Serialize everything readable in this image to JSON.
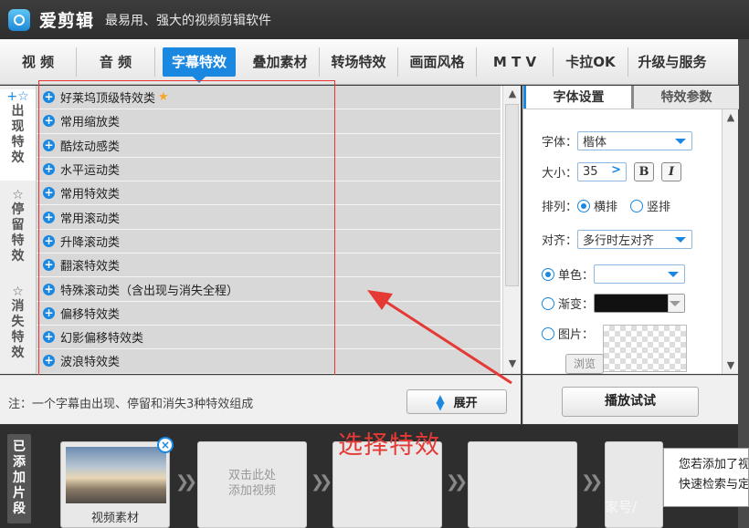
{
  "app": {
    "name": "爱剪辑",
    "slogan": "最易用、强大的视频剪辑软件"
  },
  "tabs": [
    {
      "label": "视 频"
    },
    {
      "label": "音 频"
    },
    {
      "label": "字幕特效",
      "active": true
    },
    {
      "label": "叠加素材"
    },
    {
      "label": "转场特效"
    },
    {
      "label": "画面风格"
    },
    {
      "label": "M T V"
    },
    {
      "label": "卡拉OK"
    },
    {
      "label": "升级与服务"
    }
  ],
  "side_tabs": [
    {
      "icon": "+☆",
      "label": "出现特效",
      "active": true
    },
    {
      "icon": "☆",
      "label": "停留特效"
    },
    {
      "icon": "☆",
      "label": "消失特效"
    }
  ],
  "effects": [
    {
      "label": "好莱坞顶级特效类",
      "starred": true
    },
    {
      "label": "常用缩放类"
    },
    {
      "label": "酷炫动感类"
    },
    {
      "label": "水平运动类"
    },
    {
      "label": "常用特效类"
    },
    {
      "label": "常用滚动类"
    },
    {
      "label": "升降滚动类"
    },
    {
      "label": "翻滚特效类"
    },
    {
      "label": "特殊滚动类（含出现与消失全程）"
    },
    {
      "label": "偏移特效类"
    },
    {
      "label": "幻影偏移特效类"
    },
    {
      "label": "波浪特效类"
    }
  ],
  "settings": {
    "tabs": [
      "字体设置",
      "特效参数"
    ],
    "font_label": "字体：",
    "font_value": "楷体",
    "size_label": "大小：",
    "size_value": "35",
    "bold": "B",
    "italic": "I",
    "arrange_label": "排列：",
    "horizontal": "横排",
    "vertical": "竖排",
    "align_label": "对齐：",
    "align_value": "多行时左对齐",
    "solid": "单色：",
    "gradient": "渐变：",
    "picture": "图片：",
    "browse": "浏览"
  },
  "note": "注：一个字幕由出现、停留和消失3种特效组成",
  "expand": "展开",
  "play": "播放试试",
  "clips": {
    "label": "已添加片段",
    "first_clip": "视频素材",
    "add_hint_1": "双击此处",
    "add_hint_2": "添加视频",
    "close": "×"
  },
  "tooltip": {
    "line1": "您若添加了视",
    "line2": "快速检索与定"
  },
  "watermark": "家号/",
  "annotation": "选择特效",
  "colors": {
    "accent": "#1a87e0",
    "annotation": "#e53935"
  }
}
